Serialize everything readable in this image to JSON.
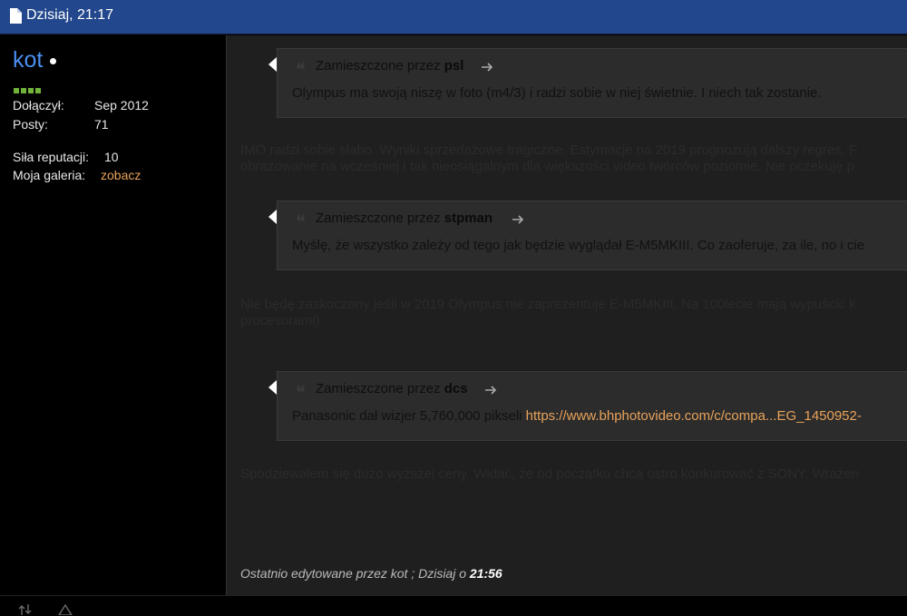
{
  "topbar": {
    "date_text": "Dzisiaj, 21:17",
    "icon": "document-icon"
  },
  "sidebar": {
    "username": "kot",
    "status_icon": "online-dot-icon",
    "reputation_blocks": 4,
    "joined_label": "Dołączył:",
    "joined_value": "Sep 2012",
    "posts_label": "Posty:",
    "posts_value": "71",
    "reputation_label": "Siła reputacji:",
    "reputation_value": "10",
    "gallery_label": "Moja galeria:",
    "gallery_link": "zobacz"
  },
  "colors": {
    "header": "#22478c",
    "username": "#4a8ff0",
    "link": "#e8a25a",
    "reputation": "#6fb33b",
    "content_bg": "#1f1f1f"
  },
  "quotes": [
    {
      "prefix": "Zamieszczone przez",
      "author": "psl",
      "text": "Olympus ma swoją niszę w foto (m4/3) i radzi sobie w niej świetnie. I niech tak zostanie."
    },
    {
      "prefix": "Zamieszczone przez",
      "author": "stpman",
      "text": "Myślę, że wszystko zależy od tego jak będzie wyglądał E-M5MKIII. Co zaoferuje, za ile, no i cie"
    },
    {
      "prefix": "Zamieszczone przez",
      "author": "dcs",
      "text": "Panasonic dał wizjer 5,760,000 pikseli",
      "link": "https://www.bhphotovideo.com/c/compa...EG_1450952-"
    }
  ],
  "faded_paragraphs": [
    "IMO radzi sobie słabo. Wyniki sprzedażowe tragiczne. Estymacje na 2019 prognozują dalszy regres. F",
    "obrazowanie na wcześniej i tak nieosiągalnym dla większości video twórców poziomie. Nie oczekuję p",
    "Nie będę zaskoczony jeśli w 2019 Olympus nie zaprezentuje E-M5MKIII. Na 100lecie mają wypuścić k",
    "procesorami)",
    "Spodziewałem się dużo wyższej ceny. Widać, że od początku chcą ostro konkurować z SONY. Wrażen"
  ],
  "edited": {
    "prefix": "Ostatnio edytowane przez kot ; Dzisiaj o",
    "time": "21:56"
  },
  "bottom_icons": [
    "sort-icon",
    "warning-icon"
  ]
}
